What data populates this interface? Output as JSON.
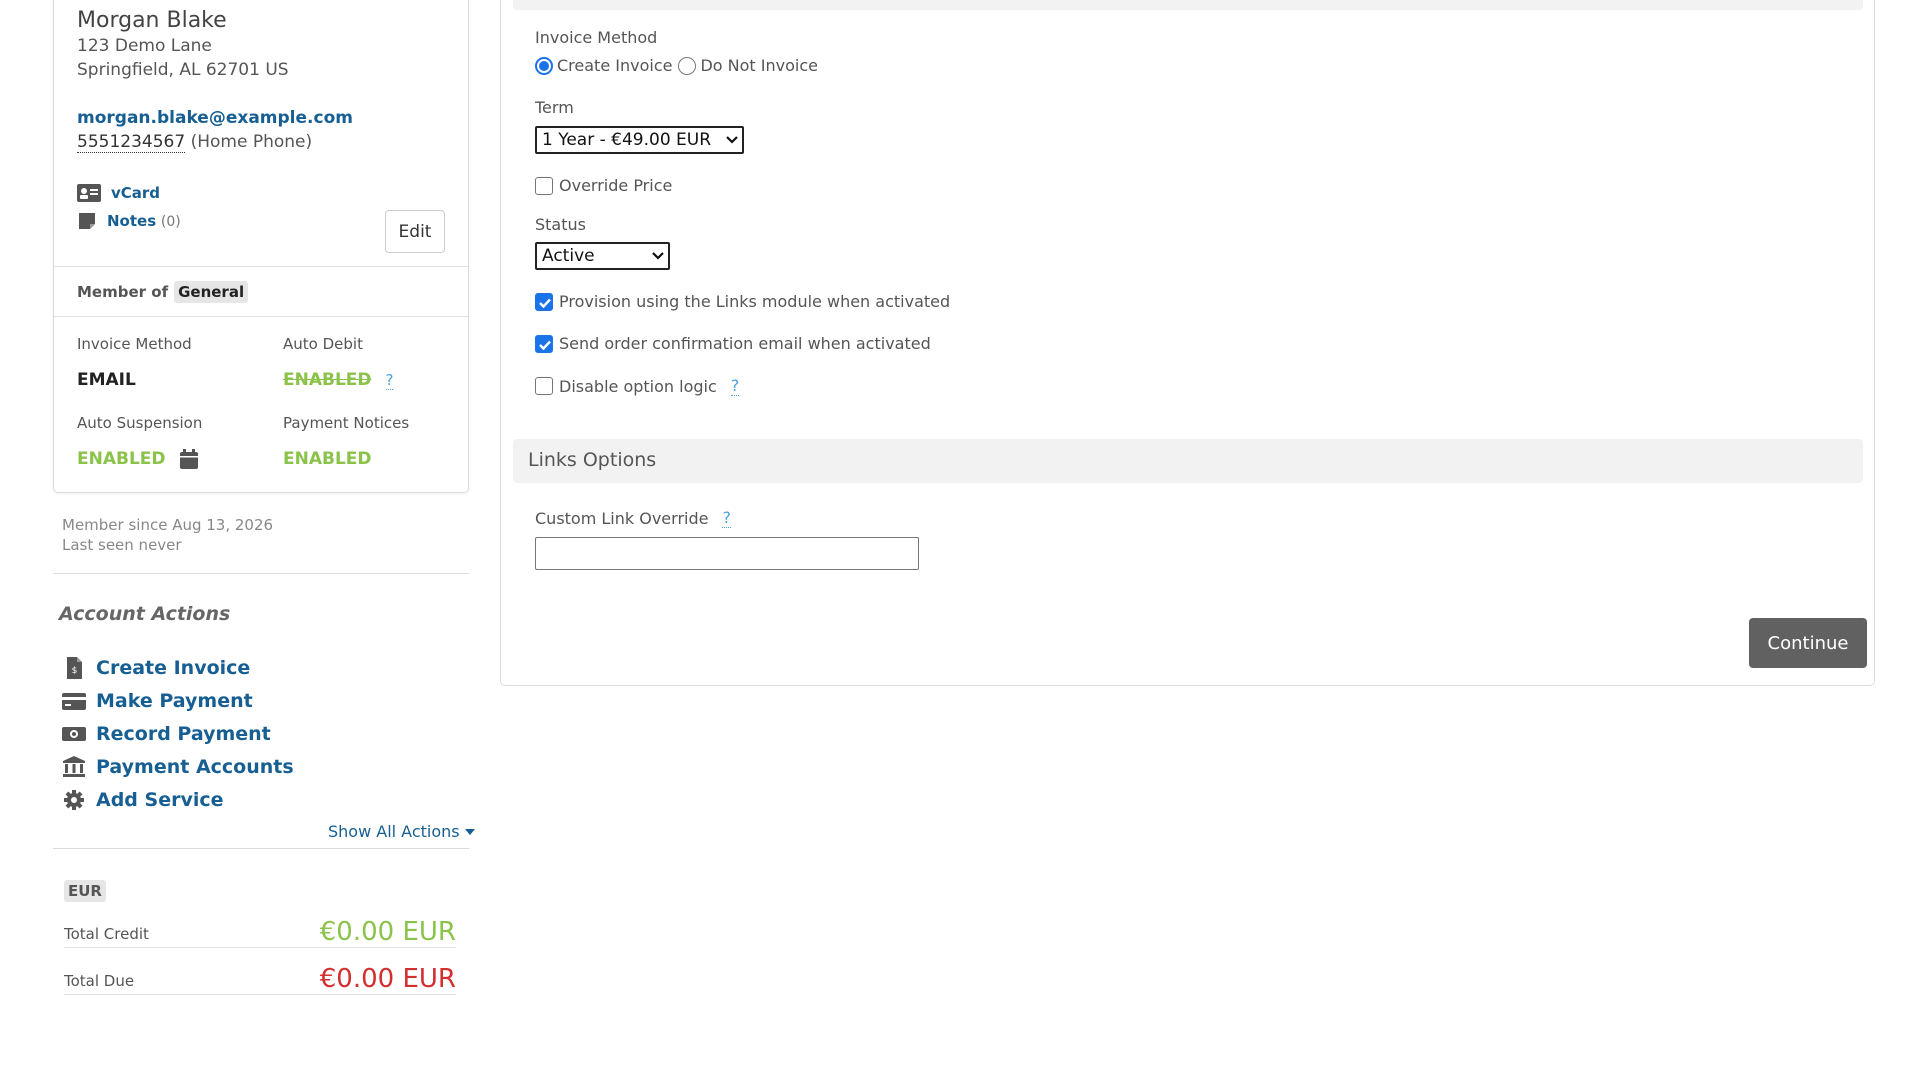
{
  "client": {
    "name": "Morgan Blake",
    "address_line1": "123 Demo Lane",
    "address_line2": "Springfield, AL 62701 US",
    "email": "morgan.blake@example.com",
    "phone": "5551234567",
    "phone_type": "(Home Phone)",
    "vcard_label": "vCard",
    "notes_label": "Notes",
    "notes_count": "(0)",
    "edit_label": "Edit",
    "member_of_label": "Member of",
    "group": "General",
    "invoice_method_label": "Invoice Method",
    "invoice_method_value": "EMAIL",
    "auto_debit_label": "Auto Debit",
    "auto_debit_value": "ENABLED",
    "auto_suspension_label": "Auto Suspension",
    "auto_suspension_value": "ENABLED",
    "payment_notices_label": "Payment Notices",
    "payment_notices_value": "ENABLED",
    "help_mark": "?",
    "member_since": "Member since Aug 13, 2026",
    "last_seen": "Last seen never"
  },
  "actions": {
    "title": "Account Actions",
    "items": [
      {
        "label": "Create Invoice",
        "icon": "invoice-icon"
      },
      {
        "label": "Make Payment",
        "icon": "credit-card-icon"
      },
      {
        "label": "Record Payment",
        "icon": "cash-icon"
      },
      {
        "label": "Payment Accounts",
        "icon": "bank-icon"
      },
      {
        "label": "Add Service",
        "icon": "gear-icon"
      }
    ],
    "show_all": "Show All Actions"
  },
  "totals": {
    "currency": "EUR",
    "credit_label": "Total Credit",
    "credit_value": "€0.00 EUR",
    "due_label": "Total Due",
    "due_value": "€0.00 EUR"
  },
  "form": {
    "invoice_method_label": "Invoice Method",
    "create_invoice": "Create Invoice",
    "do_not_invoice": "Do Not Invoice",
    "term_label": "Term",
    "term_value": "1 Year - €49.00 EUR",
    "override_price": "Override Price",
    "status_label": "Status",
    "status_value": "Active",
    "provision": "Provision using the Links module when activated",
    "send_confirmation": "Send order confirmation email when activated",
    "disable_option_logic": "Disable option logic",
    "help_mark": "?",
    "links_section": "Links Options",
    "custom_link_label": "Custom Link Override",
    "custom_link_value": "",
    "continue_label": "Continue"
  },
  "colors": {
    "link": "#175f92",
    "enabled_green": "#8bc34a",
    "due_red": "#d32f2f",
    "checkbox_blue": "#1a73e8",
    "continue_button": "#616161"
  }
}
